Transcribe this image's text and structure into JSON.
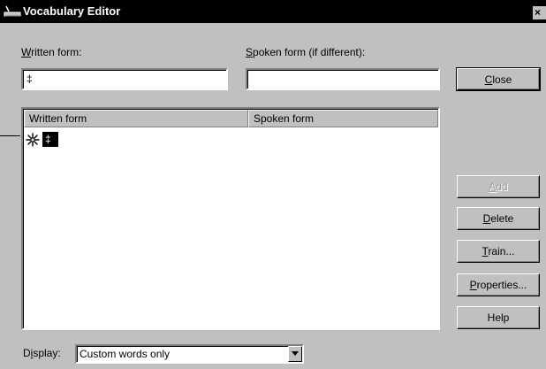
{
  "window": {
    "title": "Vocabulary Editor",
    "close_glyph": "×"
  },
  "written_form": {
    "label_key": "W",
    "label_rest": "ritten form:",
    "value": "‡"
  },
  "spoken_form": {
    "label_key": "S",
    "label_rest": "poken form (if different):",
    "value": ""
  },
  "list": {
    "columns": [
      "Written form",
      "Spoken form"
    ],
    "rows": [
      {
        "icon": "asterisk-icon",
        "written": "‡",
        "spoken": "",
        "selected": true
      }
    ]
  },
  "buttons": {
    "close": {
      "key": "C",
      "rest": "lose"
    },
    "add": {
      "key": "A",
      "rest": "dd",
      "enabled": false
    },
    "delete": {
      "key": "D",
      "rest": "elete"
    },
    "train": {
      "key": "T",
      "rest": "rain..."
    },
    "properties": {
      "key": "P",
      "rest": "roperties..."
    },
    "help": {
      "label": "Help"
    }
  },
  "display": {
    "label_pre": "D",
    "label_key": "i",
    "label_rest": "splay:",
    "value": "Custom words only"
  },
  "icons": {
    "title": "vocabulary-editor-icon",
    "dropdown": "chevron-down-icon"
  }
}
